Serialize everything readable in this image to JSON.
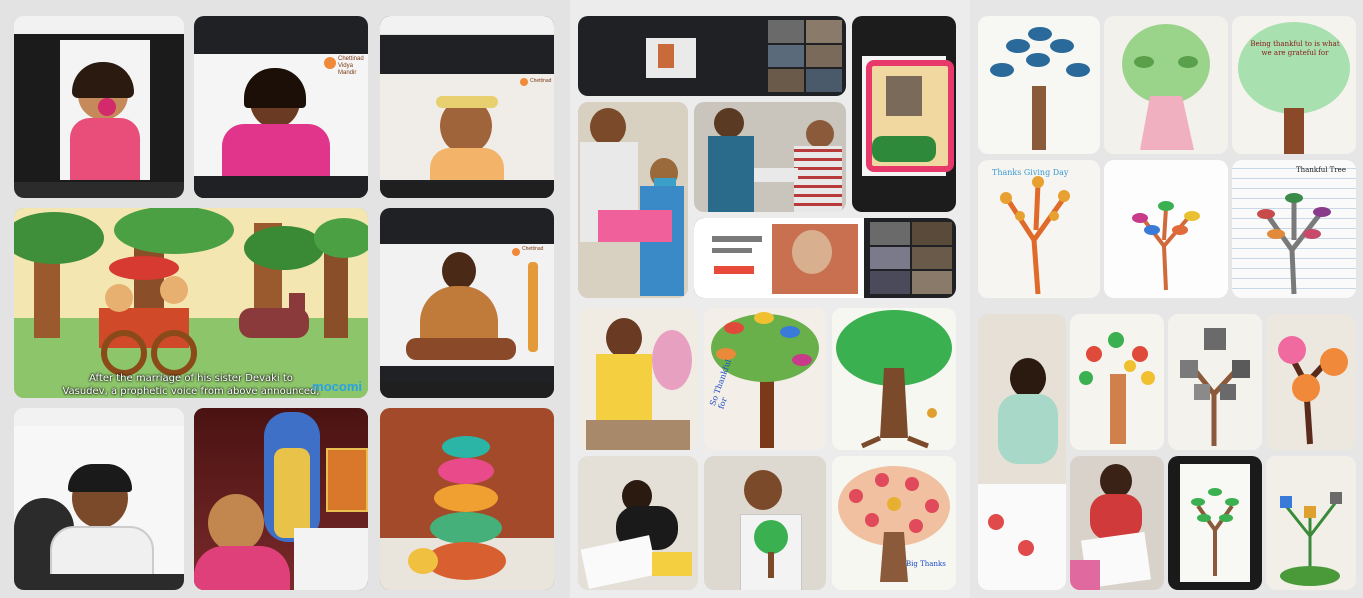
{
  "collage": {
    "left_panel": {
      "video_caption_line1": "After the marriage of his sister Devaki to",
      "video_caption_line2": "Vasudev, a prophetic voice from above announced,",
      "video_brand": "mocomi",
      "school_logo_line1": "Chettinad",
      "school_logo_line2": "Vidya Mandir"
    },
    "middle_panel": {
      "card_text_label": "So Thankful for",
      "card_text_label_2": "Big Thanks",
      "card_text_label_3": "Thankful Tree"
    },
    "right_panel": {
      "note_text": "Being thankful to is what we are grateful for",
      "drawing_label_1": "Thanks Giving Day",
      "drawing_label_2": "Thankful Tree"
    }
  }
}
